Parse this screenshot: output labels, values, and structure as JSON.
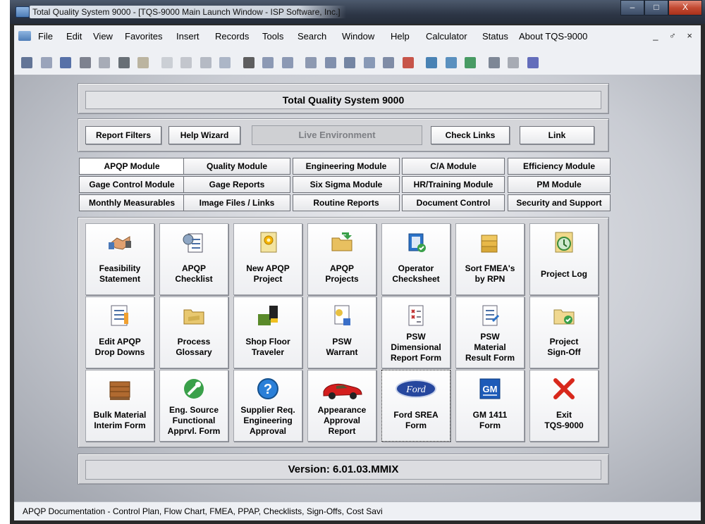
{
  "window": {
    "title": "Total Quality System 9000 - [TQS-9000 Main Launch Window - ISP Software, Inc.]",
    "controls": [
      "–",
      "□",
      "X"
    ]
  },
  "menu": {
    "items": [
      "File",
      "Edit",
      "View",
      "Favorites",
      "Insert",
      "Records",
      "Tools",
      "Search",
      "Window",
      "Help",
      "Calculator",
      "Status",
      "About TQS-9000"
    ],
    "mdi_controls": "_ ♂ ×"
  },
  "toolbar": {
    "icons": [
      "save-icon",
      "edit-icon",
      "book-icon",
      "print-preview-icon",
      "spell-check-icon",
      "print-icon",
      "binoculars-small-icon",
      "undo-icon",
      "cut-icon",
      "copy-icon",
      "paste-icon",
      "find-icon",
      "sort-asc-icon",
      "sort-desc-icon",
      "filter-icon",
      "filter-selection-icon",
      "filter-form-icon",
      "apply-filter-icon",
      "advanced-filter-icon",
      "remove-filter-icon",
      "search-web-icon",
      "home-icon",
      "globe-icon",
      "properties-icon",
      "spelling-icon",
      "format-icon"
    ]
  },
  "header": {
    "title": "Total Quality System 9000",
    "buttons": [
      "Report Filters",
      "Help Wizard",
      "Check Links",
      "Link"
    ],
    "environment": "Live Environment"
  },
  "tabs": [
    [
      "APQP Module",
      "Quality Module",
      "Engineering Module",
      "C/A Module",
      "Efficiency Module"
    ],
    [
      "Gage Control Module",
      "Gage Reports",
      "Six Sigma Module",
      "HR/Training Module",
      "PM Module"
    ],
    [
      "Monthly Measurables",
      "Image Files / Links",
      "Routine Reports",
      "Document Control",
      "Security and Support"
    ]
  ],
  "active_tab": "APQP Module",
  "tiles": [
    [
      {
        "label": "Feasibility\nStatement",
        "icon": "handshake-icon"
      },
      {
        "label": "APQP\nChecklist",
        "icon": "checklist-icon"
      },
      {
        "label": "New APQP\nProject",
        "icon": "new-project-icon"
      },
      {
        "label": "APQP\nProjects",
        "icon": "projects-folder-icon"
      },
      {
        "label": "Operator\nChecksheet",
        "icon": "checksheet-icon"
      },
      {
        "label": "Sort FMEA's\nby RPN",
        "icon": "sort-folders-icon"
      },
      {
        "label": "Project Log",
        "icon": "project-log-icon"
      }
    ],
    [
      {
        "label": "Edit APQP\nDrop Downs",
        "icon": "edit-list-icon"
      },
      {
        "label": "Process\nGlossary",
        "icon": "glossary-folder-icon"
      },
      {
        "label": "Shop Floor\nTraveler",
        "icon": "forklift-icon"
      },
      {
        "label": "PSW\nWarrant",
        "icon": "warrant-icon"
      },
      {
        "label": "PSW\nDimensional\nReport Form",
        "icon": "dimensional-report-icon"
      },
      {
        "label": "PSW\nMaterial\nResult Form",
        "icon": "material-result-icon"
      },
      {
        "label": "Project\nSign-Off",
        "icon": "sign-off-icon"
      }
    ],
    [
      {
        "label": "Bulk Material\nInterim Form",
        "icon": "crate-icon"
      },
      {
        "label": "Eng. Source\nFunctional\nApprvl. Form",
        "icon": "wrench-globe-icon"
      },
      {
        "label": "Supplier Req.\nEngineering\nApproval",
        "icon": "question-icon"
      },
      {
        "label": "Appearance\nApproval\nReport",
        "icon": "sports-car-icon"
      },
      {
        "label": "Ford SREA\nForm",
        "icon": "ford-logo-icon"
      },
      {
        "label": "GM 1411\nForm",
        "icon": "gm-logo-icon"
      },
      {
        "label": "Exit\nTQS-9000",
        "icon": "exit-x-icon"
      }
    ]
  ],
  "logos": {
    "ford": "Ford",
    "gm": "GM"
  },
  "version": "Version: 6.01.03.MMIX",
  "status": "APQP Documentation - Control Plan, Flow Chart, FMEA, PPAP, Checklists, Sign-Offs, Cost Savi",
  "colors": {
    "titlebar": "#2d3646",
    "close": "#c34a32",
    "client": "#c9ccd3"
  }
}
